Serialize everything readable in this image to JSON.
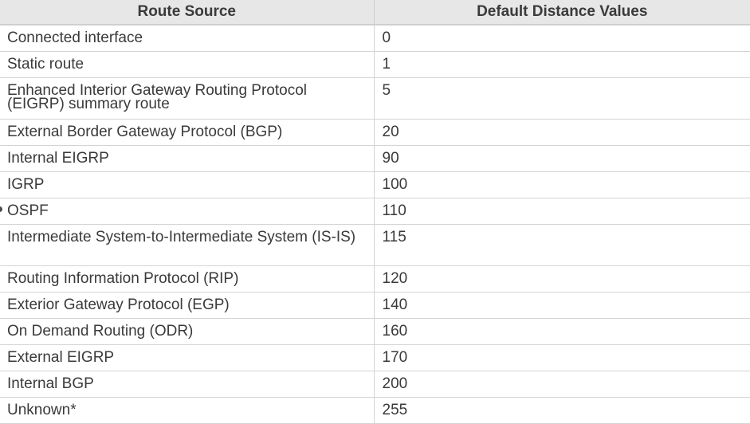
{
  "table": {
    "headers": [
      "Route Source",
      "Default Distance Values"
    ],
    "rows": [
      {
        "source": "Connected interface",
        "value": "0"
      },
      {
        "source": "Static route",
        "value": "1"
      },
      {
        "source": "Enhanced Interior Gateway Routing Protocol (EIGRP) summary route",
        "value": "5"
      },
      {
        "source": "External Border Gateway Protocol (BGP)",
        "value": "20"
      },
      {
        "source": "Internal EIGRP",
        "value": "90"
      },
      {
        "source": "IGRP",
        "value": "100"
      },
      {
        "source": "OSPF",
        "value": "110"
      },
      {
        "source": "Intermediate System-to-Intermediate System (IS-IS)",
        "value": "115"
      },
      {
        "source": "Routing Information Protocol (RIP)",
        "value": "120"
      },
      {
        "source": "Exterior Gateway Protocol (EGP)",
        "value": "140"
      },
      {
        "source": "On Demand Routing (ODR)",
        "value": "160"
      },
      {
        "source": "External EIGRP",
        "value": "170"
      },
      {
        "source": "Internal BGP",
        "value": "200"
      },
      {
        "source": "Unknown*",
        "value": "255"
      }
    ]
  }
}
